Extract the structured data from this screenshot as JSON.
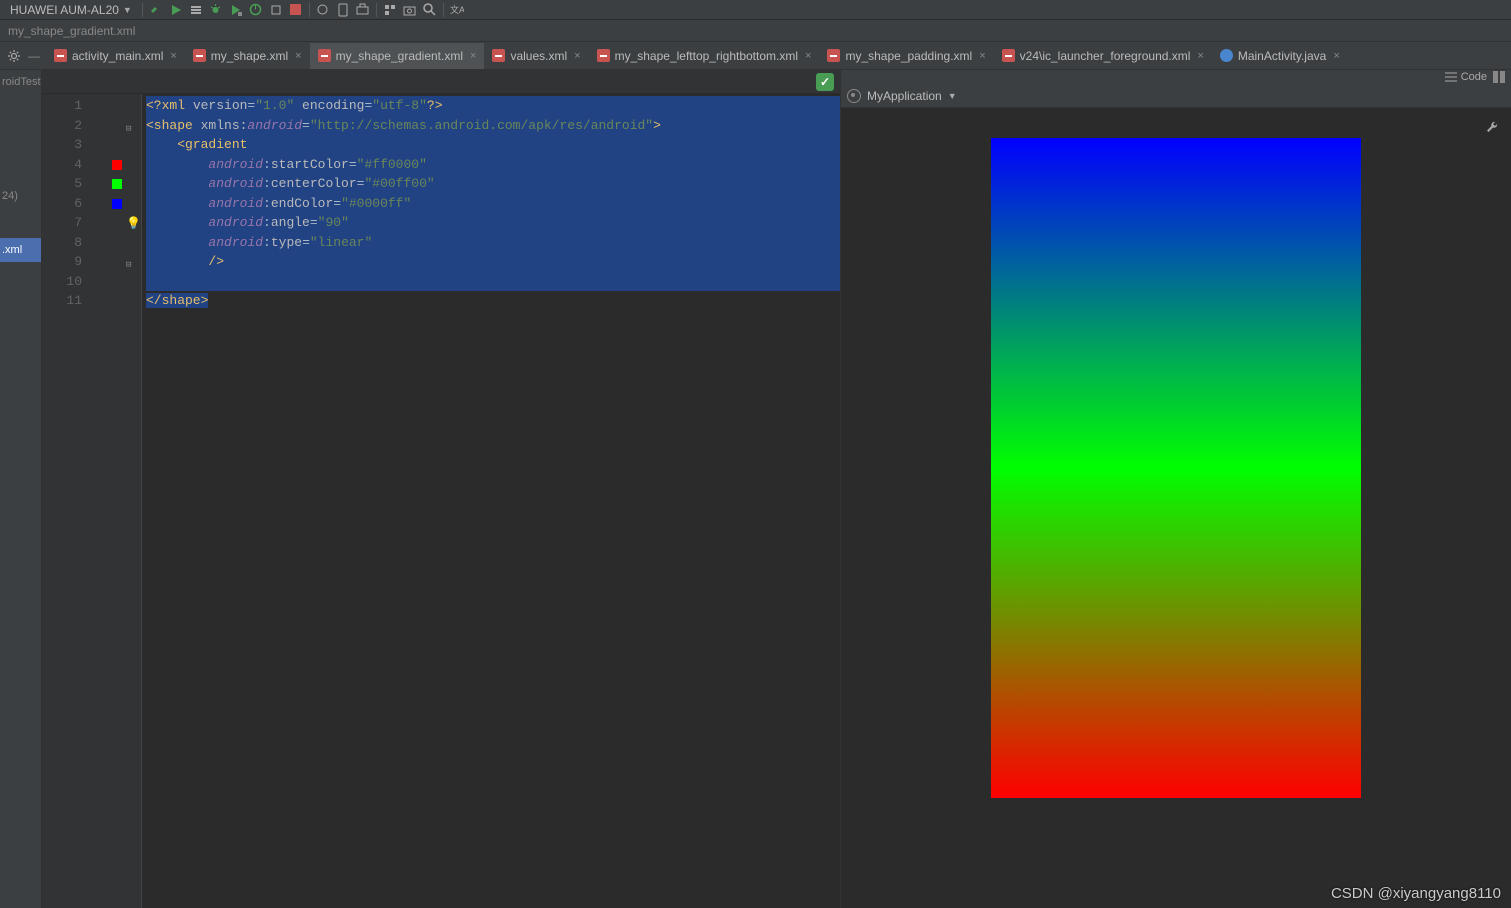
{
  "toolbar": {
    "device": "HUAWEI AUM-AL20"
  },
  "breadcrumb": "my_shape_gradient.xml",
  "tabs": [
    {
      "label": "activity_main.xml",
      "type": "xml",
      "active": false
    },
    {
      "label": "my_shape.xml",
      "type": "xml",
      "active": false
    },
    {
      "label": "my_shape_gradient.xml",
      "type": "xml",
      "active": true
    },
    {
      "label": "values.xml",
      "type": "xml",
      "active": false
    },
    {
      "label": "my_shape_lefttop_rightbottom.xml",
      "type": "xml",
      "active": false
    },
    {
      "label": "my_shape_padding.xml",
      "type": "xml",
      "active": false
    },
    {
      "label": "v24\\ic_launcher_foreground.xml",
      "type": "xml",
      "active": false
    },
    {
      "label": "MainActivity.java",
      "type": "java",
      "active": false
    }
  ],
  "sidebar": {
    "items": [
      "roidTest",
      "24)",
      ".xml"
    ]
  },
  "code": {
    "lines": [
      1,
      2,
      3,
      4,
      5,
      6,
      7,
      8,
      9,
      10,
      11
    ],
    "swatches": [
      {
        "line": 4,
        "color": "#ff0000"
      },
      {
        "line": 5,
        "color": "#00ff00"
      },
      {
        "line": 6,
        "color": "#0000ff"
      }
    ],
    "text": {
      "l1_a": "<?xml ",
      "l1_b": "version",
      "l1_c": "=",
      "l1_d": "\"1.0\" ",
      "l1_e": "encoding",
      "l1_f": "=",
      "l1_g": "\"utf-8\"",
      "l1_h": "?>",
      "l2_a": "<shape ",
      "l2_b": "xmlns:",
      "l2_c": "android",
      "l2_d": "=",
      "l2_e": "\"http://schemas.android.com/apk/res/android\"",
      "l2_f": ">",
      "l3_a": "    <gradient",
      "l4_a": "        ",
      "l4_ns": "android",
      "l4_c": ":",
      "l4_at": "startColor",
      "l4_e": "=",
      "l4_v": "\"#ff0000\"",
      "l5_a": "        ",
      "l5_ns": "android",
      "l5_c": ":",
      "l5_at": "centerColor",
      "l5_e": "=",
      "l5_v": "\"#00ff00\"",
      "l6_a": "        ",
      "l6_ns": "android",
      "l6_c": ":",
      "l6_at": "endColor",
      "l6_e": "=",
      "l6_v": "\"#0000ff\"",
      "l7_a": "        ",
      "l7_ns": "android",
      "l7_c": ":",
      "l7_at": "angle",
      "l7_e": "=",
      "l7_v": "\"90\"",
      "l8_a": "        ",
      "l8_ns": "android",
      "l8_c": ":",
      "l8_at": "type",
      "l8_e": "=",
      "l8_v": "\"linear\"",
      "l9_a": "        />",
      "l10_a": "",
      "l11_a": "</shape>"
    }
  },
  "preview": {
    "project": "MyApplication",
    "tabLabel": "Code"
  },
  "watermark": "CSDN @xiyangyang8110",
  "gradient": {
    "start": "#ff0000",
    "center": "#00ff00",
    "end": "#0000ff",
    "angle": 90,
    "type": "linear"
  }
}
